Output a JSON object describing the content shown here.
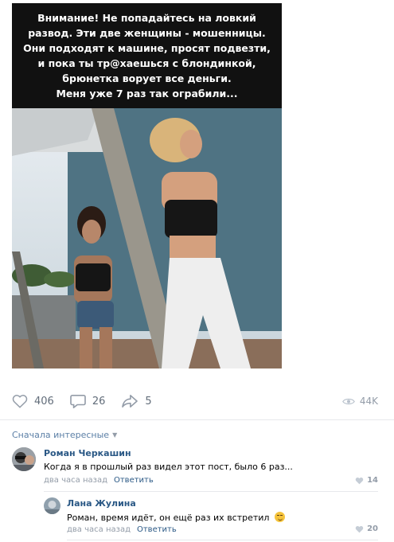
{
  "post": {
    "caption_lines": [
      "Внимание! Не попадайтесь на ловкий",
      "развод. Эти две женщины - мошенницы.",
      "Они подходят к машине, просят подвезти,",
      "и пока ты тр@хаешься с блондинкой,",
      "брюнетка ворует все деньги.",
      "Меня уже 7 раз так ограбили..."
    ]
  },
  "actions": {
    "likes": "406",
    "comments": "26",
    "shares": "5",
    "views": "44K"
  },
  "comments_section": {
    "sort_label": "Сначала интересные",
    "comments": [
      {
        "author": "Роман Черкашин",
        "text": "Когда я в прошлый раз видел этот пост, было 6 раз...",
        "time": "два часа назад",
        "reply_label": "Ответить",
        "likes": "14"
      },
      {
        "author": "Лана Жулина",
        "text": "Роман, время идёт, он ещё раз их встретил",
        "time": "два часа назад",
        "reply_label": "Ответить",
        "likes": "20"
      }
    ]
  }
}
